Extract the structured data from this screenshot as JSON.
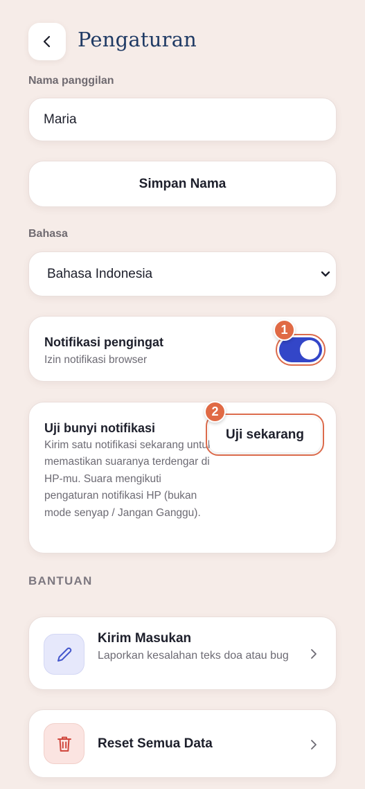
{
  "header": {
    "title": "Pengaturan",
    "back_icon": "chevron-left-icon"
  },
  "nickname": {
    "label": "Nama panggilan",
    "value": "Maria",
    "save_label": "Simpan Nama"
  },
  "language": {
    "label": "Bahasa",
    "selected": "Bahasa Indonesia"
  },
  "reminder": {
    "title": "Notifikasi pengingat",
    "subtitle": "Izin notifikasi browser",
    "enabled": true,
    "badge": "1"
  },
  "sound_test": {
    "title": "Uji bunyi notifikasi",
    "description": "Kirim satu notifikasi sekarang untuk memastikan suaranya terdengar di HP-mu. Suara mengikuti pengaturan notifikasi HP (bukan mode senyap / Jangan Ganggu).",
    "button_label": "Uji sekarang",
    "badge": "2"
  },
  "help": {
    "section_label": "BANTUAN",
    "items": [
      {
        "title": "Kirim Masukan",
        "subtitle": "Laporkan kesalahan teks doa atau bug",
        "icon": "pencil-icon"
      },
      {
        "title": "Reset Semua Data",
        "icon": "trash-icon"
      }
    ]
  },
  "colors": {
    "background": "#f6ece8",
    "accent": "#3346c8",
    "highlight": "#dc6b4c",
    "title": "#1f3a64"
  }
}
